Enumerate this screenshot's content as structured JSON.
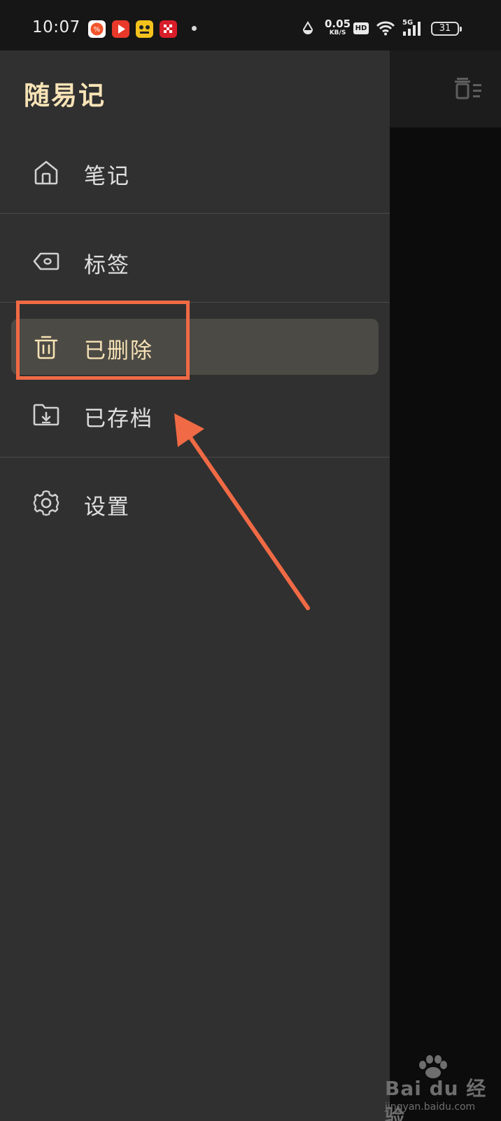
{
  "status_bar": {
    "time": "10:07",
    "net_speed_value": "0.05",
    "net_speed_unit": "KB/S",
    "hd_label": "HD",
    "signal_label": "5G",
    "battery_level": "31",
    "colors": {
      "app1": "#f2552c",
      "app2": "#e8392a",
      "app3": "#f4c21c",
      "app4": "#d81e2a"
    }
  },
  "drawer": {
    "title": "随易记",
    "items": [
      {
        "label": "笔记",
        "icon": "home-icon",
        "selected": false
      },
      {
        "label": "标签",
        "icon": "tag-icon",
        "selected": false
      },
      {
        "label": "已删除",
        "icon": "trash-icon",
        "selected": true
      },
      {
        "label": "已存档",
        "icon": "archive-folder-icon",
        "selected": false
      },
      {
        "label": "设置",
        "icon": "gear-icon",
        "selected": false
      }
    ]
  },
  "toolbar": {
    "icon": "delete-list-icon"
  },
  "annotation": {
    "color": "#ef6a45"
  },
  "watermark": {
    "brand": "Bai du 经验",
    "url": "jingyan.baidu.com"
  },
  "colors": {
    "accent": "#f7e3b6",
    "drawer_bg": "#303030",
    "selected_bg": "#4c4a44"
  }
}
